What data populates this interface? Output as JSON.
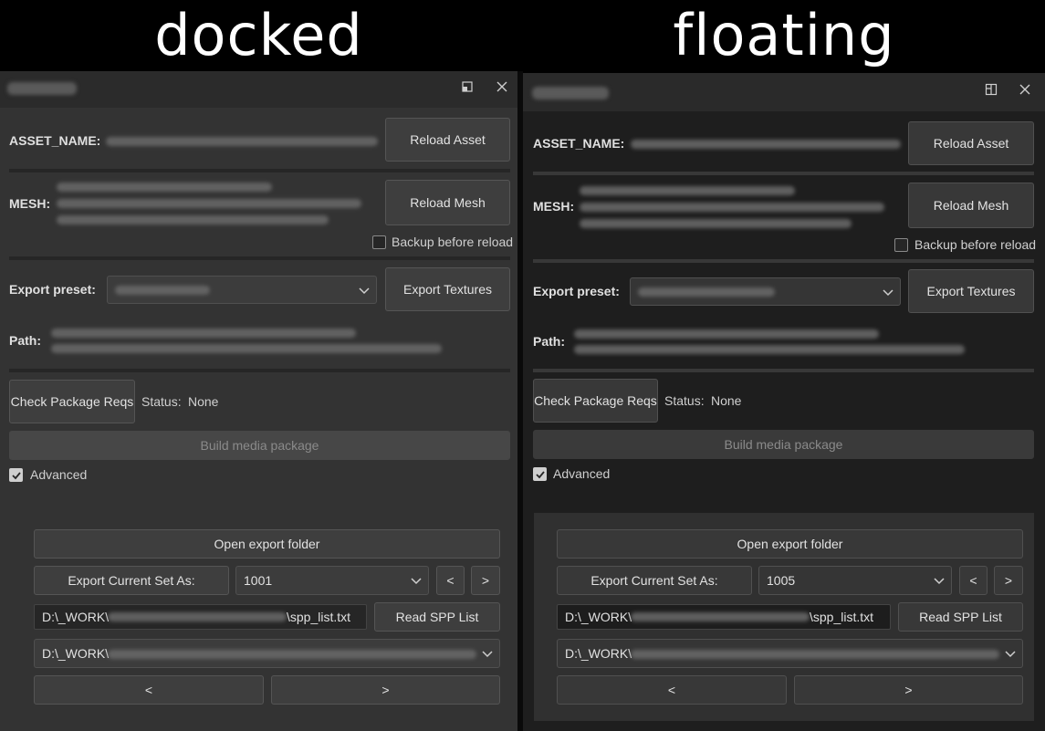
{
  "headers": {
    "left": "docked",
    "right": "floating"
  },
  "panels": [
    {
      "asset_label": "ASSET_NAME:",
      "reload_asset": "Reload Asset",
      "mesh_label": "MESH:",
      "reload_mesh": "Reload Mesh",
      "backup_label": "Backup before reload",
      "backup_checked": false,
      "export_preset_label": "Export preset:",
      "export_textures": "Export Textures",
      "path_label": "Path:",
      "check_reqs": "Check Package Reqs",
      "status_label": "Status:",
      "status_value": "None",
      "build_package": "Build media package",
      "advanced_label": "Advanced",
      "advanced_checked": true,
      "open_export_folder": "Open export folder",
      "export_set_as": "Export Current Set As:",
      "set_value": "1001",
      "prev": "<",
      "next": ">",
      "spp_prefix": "D:\\_WORK\\",
      "spp_suffix": "\\spp_list.txt",
      "read_spp": "Read SPP List",
      "output_prefix": "D:\\_WORK\\",
      "bottom_prev": "<",
      "bottom_next": ">"
    },
    {
      "asset_label": "ASSET_NAME:",
      "reload_asset": "Reload Asset",
      "mesh_label": "MESH:",
      "reload_mesh": "Reload Mesh",
      "backup_label": "Backup before reload",
      "backup_checked": false,
      "export_preset_label": "Export preset:",
      "export_textures": "Export Textures",
      "path_label": "Path:",
      "check_reqs": "Check Package Reqs",
      "status_label": "Status:",
      "status_value": "None",
      "build_package": "Build media package",
      "advanced_label": "Advanced",
      "advanced_checked": true,
      "open_export_folder": "Open export folder",
      "export_set_as": "Export Current Set As:",
      "set_value": "1005",
      "prev": "<",
      "next": ">",
      "spp_prefix": "D:\\_WORK\\",
      "spp_suffix": "\\spp_list.txt",
      "read_spp": "Read SPP List",
      "output_prefix": "D:\\_WORK\\",
      "bottom_prev": "<",
      "bottom_next": ">"
    }
  ],
  "icons": {
    "docked_titlebar": [
      "undock-icon",
      "close-icon"
    ],
    "floating_titlebar": [
      "dock-icon",
      "close-icon"
    ],
    "combo": "chevron-down-icon",
    "checkbox": "check-icon"
  }
}
